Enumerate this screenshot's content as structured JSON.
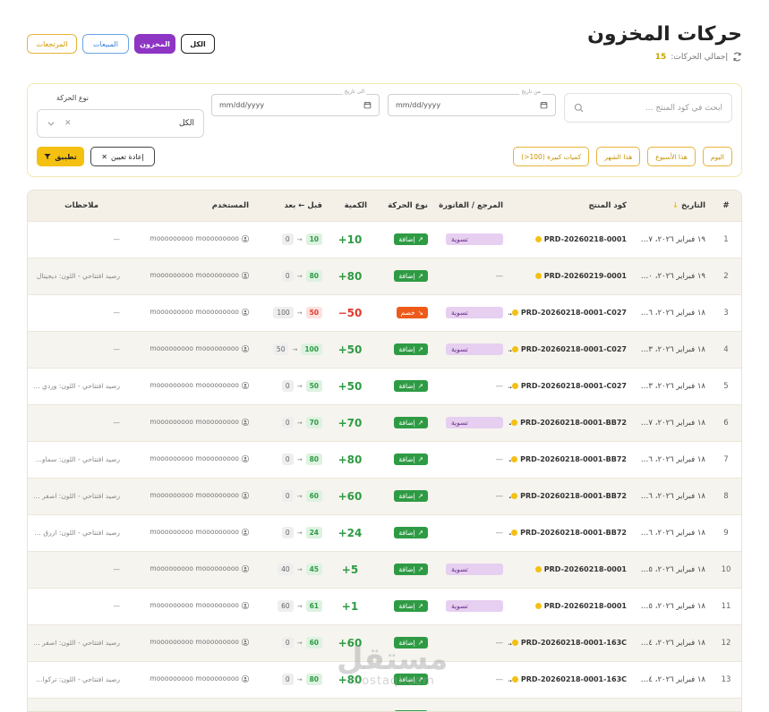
{
  "header": {
    "title": "حركات المخزون",
    "total_label": "إجمالي الحركات:",
    "total_count": "15"
  },
  "tabs": {
    "returns": "المرتجعات",
    "sales": "المبيعات",
    "inventory": "المخزون",
    "all": "الكل"
  },
  "filters": {
    "search_placeholder": "ابحث في كود المنتج ...",
    "date_from_label": "من تاريخ",
    "date_from_value": "mm/dd/yyyy",
    "date_to_label": "الى تاريخ",
    "date_to_value": "mm/dd/yyyy",
    "type_label": "نوع الحركة",
    "type_value": "الكل",
    "quick": {
      "today": "اليوم",
      "week": "هذا الأسبوع",
      "month": "هذا الشهر",
      "large": "كميات كبيرة (100<)"
    },
    "apply": "تطبيق",
    "reset": "إعادة تعيين"
  },
  "table": {
    "headers": {
      "index": "#",
      "date": "التاريخ",
      "code": "كود المنتج",
      "ref": "المرجع / الفاتورة",
      "type": "نوع الحركة",
      "qty": "الكمية",
      "before_after": "قبل ← بعد",
      "user": "المستخدم",
      "notes": "ملاحظات"
    },
    "rows": [
      {
        "n": "1",
        "date": "١٩ فبراير ٢٠٢٦، ٠٣:٣٧ م",
        "code": "PRD-20260218-0001",
        "ref": "تسوية",
        "type": "إضافة",
        "kind": "add",
        "qty": "10+",
        "before": "0",
        "after": "10",
        "user": "mooooooooo mooooooooo",
        "notes": "—"
      },
      {
        "n": "2",
        "date": "١٩ فبراير ٢٠٢٦، ٠٣:١٠ م",
        "code": "PRD-20260219-0001",
        "ref": "",
        "type": "إضافة",
        "kind": "add",
        "qty": "80+",
        "before": "0",
        "after": "80",
        "user": "mooooooooo mooooooooo",
        "notes": "رصيد افتتاحي - اللون: ديجيتال"
      },
      {
        "n": "3",
        "date": "١٨ فبراير ٢٠٢٦، ٠٧:٣٦ م",
        "code": "PRD-20260218-0001-C027",
        "ref": "تسوية",
        "type": "خصم",
        "kind": "sub",
        "qty": "50−",
        "before": "100",
        "after": "50",
        "user": "mooooooooo mooooooooo",
        "notes": "—"
      },
      {
        "n": "4",
        "date": "١٨ فبراير ٢٠٢٦، ٠٧:٣٣ م",
        "code": "PRD-20260218-0001-C027",
        "ref": "تسوية",
        "type": "إضافة",
        "kind": "add",
        "qty": "50+",
        "before": "50",
        "after": "100",
        "user": "mooooooooo mooooooooo",
        "notes": "—"
      },
      {
        "n": "5",
        "date": "١٨ فبراير ٢٠٢٦، ٠٧:٠٣ م",
        "code": "PRD-20260218-0001-C027",
        "ref": "",
        "type": "إضافة",
        "kind": "add",
        "qty": "50+",
        "before": "0",
        "after": "50",
        "user": "mooooooooo mooooooooo",
        "notes": "رصيد افتتاحي - اللون: وردي 0..."
      },
      {
        "n": "6",
        "date": "١٨ فبراير ٢٠٢٦، ٠٦:٣٧ م",
        "code": "PRD-20260218-0001-BB72",
        "ref": "تسوية",
        "type": "إضافة",
        "kind": "add",
        "qty": "70+",
        "before": "0",
        "after": "70",
        "user": "mooooooooo mooooooooo",
        "notes": "—"
      },
      {
        "n": "7",
        "date": "١٨ فبراير ٢٠٢٦، ٠٦:٣٦ م",
        "code": "PRD-20260218-0001-BB72",
        "ref": "",
        "type": "إضافة",
        "kind": "add",
        "qty": "80+",
        "before": "0",
        "after": "80",
        "user": "mooooooooo mooooooooo",
        "notes": "رصيد افتتاحي - اللون: سماو..."
      },
      {
        "n": "8",
        "date": "١٨ فبراير ٢٠٢٦، ٠٦:٣٦ م",
        "code": "PRD-20260218-0001-BB72",
        "ref": "",
        "type": "إضافة",
        "kind": "add",
        "qty": "60+",
        "before": "0",
        "after": "60",
        "user": "mooooooooo mooooooooo",
        "notes": "رصيد افتتاحي - اللون: اصفر 0..."
      },
      {
        "n": "9",
        "date": "١٨ فبراير ٢٠٢٦، ٠٦:٣٦ م",
        "code": "PRD-20260218-0001-BB72",
        "ref": "",
        "type": "إضافة",
        "kind": "add",
        "qty": "24+",
        "before": "0",
        "after": "24",
        "user": "mooooooooo mooooooooo",
        "notes": "رصيد افتتاحي - اللون: ازرق 300"
      },
      {
        "n": "10",
        "date": "١٨ فبراير ٢٠٢٦، ٠٧:٣٥ ص",
        "code": "PRD-20260218-0001",
        "ref": "تسوية",
        "type": "إضافة",
        "kind": "add",
        "qty": "5+",
        "before": "40",
        "after": "45",
        "user": "mooooooooo mooooooooo",
        "notes": "—"
      },
      {
        "n": "11",
        "date": "١٨ فبراير ٢٠٢٦، ٠٧:٣٥ ص",
        "code": "PRD-20260218-0001",
        "ref": "تسوية",
        "type": "إضافة",
        "kind": "add",
        "qty": "1+",
        "before": "60",
        "after": "61",
        "user": "mooooooooo mooooooooo",
        "notes": "—"
      },
      {
        "n": "12",
        "date": "١٨ فبراير ٢٠٢٦، ٠٧:٣٤ ص",
        "code": "PRD-20260218-0001-163C",
        "ref": "",
        "type": "إضافة",
        "kind": "add",
        "qty": "60+",
        "before": "0",
        "after": "60",
        "user": "mooooooooo mooooooooo",
        "notes": "رصيد افتتاحي - اللون: اصفر 0..."
      },
      {
        "n": "13",
        "date": "١٨ فبراير ٢٠٢٦، ٠٧:٣٤ ص",
        "code": "PRD-20260218-0001-163C",
        "ref": "",
        "type": "إضافة",
        "kind": "add",
        "qty": "80+",
        "before": "0",
        "after": "80",
        "user": "mooooooooo mooooooooo",
        "notes": "رصيد افتتاحي - اللون: تركواز..."
      },
      {
        "n": "",
        "date": "",
        "code": "",
        "ref": "",
        "type": "إضافة",
        "kind": "add",
        "qty": "80+",
        "before": "",
        "after": "",
        "user": "",
        "notes": ""
      }
    ]
  },
  "colors": {
    "accent_yellow": "#f4c012",
    "inventory_purple": "#8e35c4",
    "add_green": "#2e9b44",
    "sub_orange": "#ee5a1a"
  },
  "watermark": {
    "ar": "مستقل",
    "en": "mostaql.com"
  }
}
